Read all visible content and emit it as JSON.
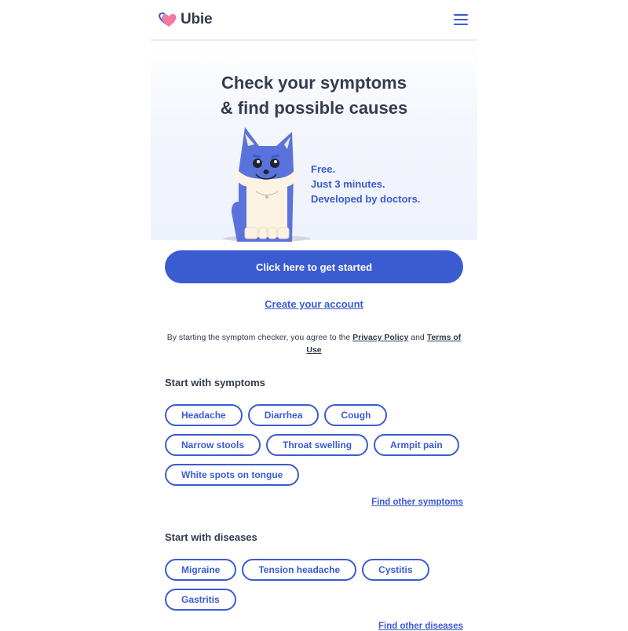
{
  "header": {
    "brand": "Ubie",
    "menu_icon": "hamburger-menu-icon"
  },
  "hero": {
    "title_line1": "Check your symptoms",
    "title_line2": "& find possible causes",
    "taglines": [
      "Free.",
      "Just 3 minutes.",
      "Developed by doctors."
    ],
    "mascot": "husky-dog-mascot"
  },
  "actions": {
    "start_label": "Click here to get started",
    "create_account_label": "Create your account"
  },
  "legal": {
    "prefix": "By starting the symptom checker, you agree to the ",
    "privacy_label": "Privacy Policy",
    "middle": " and ",
    "terms_label": "Terms of Use"
  },
  "symptoms": {
    "title": "Start with symptoms",
    "items": [
      "Headache",
      "Diarrhea",
      "Cough",
      "Narrow stools",
      "Throat swelling",
      "Armpit pain",
      "White spots on tongue"
    ],
    "more_label": "Find other symptoms"
  },
  "diseases": {
    "title": "Start with diseases",
    "items": [
      "Migraine",
      "Tension headache",
      "Cystitis",
      "Gastritis"
    ],
    "more_label": "Find other diseases"
  },
  "colors": {
    "brand_blue": "#3b5bd1",
    "heart_pink": "#f27ba6",
    "text_dark": "#303a4d"
  }
}
